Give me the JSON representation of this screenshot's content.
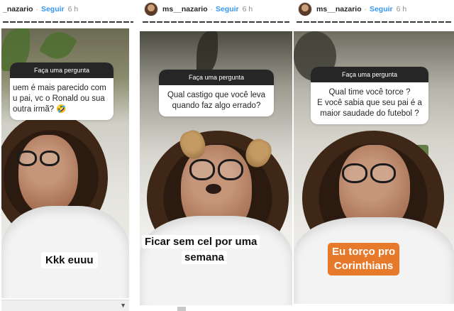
{
  "stories": [
    {
      "header": {
        "username": "_nazario",
        "follow": "Seguir",
        "time": "6 h"
      },
      "question_header": "Faça uma pergunta",
      "question": [
        "uem é mais parecido com",
        "u pai, vc o Ronald ou sua",
        "outra irmã? 🤣"
      ],
      "answer": "Kkk euuu"
    },
    {
      "header": {
        "username": "ms__nazario",
        "follow": "Seguir",
        "time": "6 h"
      },
      "question_header": "Faça uma pergunta",
      "question": [
        "Qual castigo que você leva",
        "quando faz algo errado?"
      ],
      "answer": [
        "Ficar sem cel por uma",
        "semana"
      ]
    },
    {
      "header": {
        "username": "ms__nazario",
        "follow": "Seguir",
        "time": "6 h"
      },
      "question_header": "Faça uma pergunta",
      "question": [
        "Qual time você torce ?",
        "E você sabia que seu pai é a",
        "maior saudade do futebol ?"
      ],
      "answer": [
        "Eu torço pro",
        "Corinthians"
      ]
    }
  ],
  "colors": {
    "follow": "#3897f0",
    "answer3_bg": "#e77a2a",
    "question_header_bg": "#262626"
  },
  "separator": "·",
  "scroll_arrow": "▼"
}
